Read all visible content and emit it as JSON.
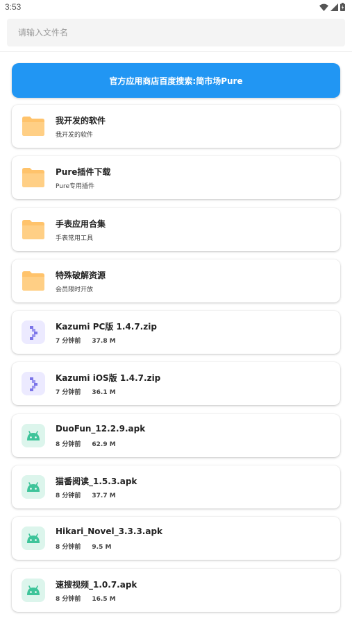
{
  "status": {
    "time": "3:53"
  },
  "search": {
    "placeholder": "请输入文件名",
    "value": ""
  },
  "banner": {
    "text": "官方应用商店百度搜索:简市场Pure"
  },
  "colors": {
    "accent": "#2196f3",
    "folder": "#ffc36b",
    "kazumi": "#7b74e8",
    "android": "#3ec49a"
  },
  "folders": [
    {
      "title": "我开发的软件",
      "subtitle": "我开发的软件",
      "icon": "folder-icon"
    },
    {
      "title": "Pure插件下载",
      "subtitle": "Pure专用插件",
      "icon": "folder-icon"
    },
    {
      "title": "手表应用合集",
      "subtitle": "手表常用工具",
      "icon": "folder-icon"
    },
    {
      "title": "特殊破解资源",
      "subtitle": "会员限时开放",
      "icon": "folder-icon"
    }
  ],
  "files": [
    {
      "name": "Kazumi PC版 1.4.7.zip",
      "time": "7 分钟前",
      "size": "37.8 M",
      "icon": "kazumi-icon"
    },
    {
      "name": "Kazumi iOS版 1.4.7.zip",
      "time": "7 分钟前",
      "size": "36.1 M",
      "icon": "kazumi-icon"
    },
    {
      "name": "DuoFun_12.2.9.apk",
      "time": "8 分钟前",
      "size": "62.9 M",
      "icon": "android-icon"
    },
    {
      "name": "猫番阅读_1.5.3.apk",
      "time": "8 分钟前",
      "size": "37.7 M",
      "icon": "android-icon"
    },
    {
      "name": "Hikari_Novel_3.3.3.apk",
      "time": "8 分钟前",
      "size": "9.5 M",
      "icon": "android-icon"
    },
    {
      "name": "速搜视频_1.0.7.apk",
      "time": "8 分钟前",
      "size": "16.5 M",
      "icon": "android-icon"
    }
  ]
}
